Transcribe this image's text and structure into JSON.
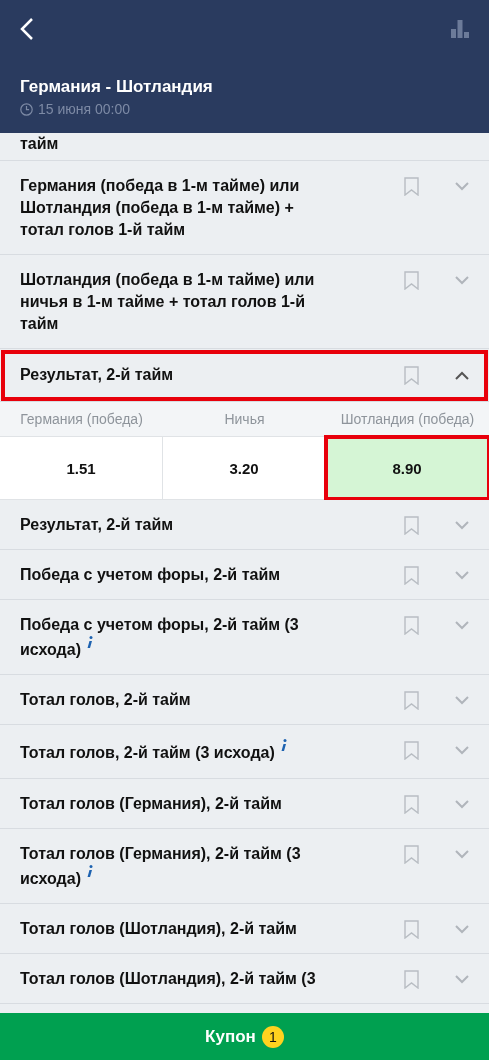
{
  "header": {
    "title": "Германия - Шотландия",
    "datetime": "15 июня 00:00"
  },
  "markets": [
    {
      "title": "тайм",
      "partial": true,
      "expanded": false,
      "highlighted": false
    },
    {
      "title": "Германия (победа в 1-м тайме) или Шотландия (победа в 1-м тайме) + тотал голов 1-й тайм",
      "expanded": false,
      "highlighted": false
    },
    {
      "title": "Шотландия (победа в 1-м тайме) или ничья в 1-м тайме + тотал голов 1-й тайм",
      "expanded": false,
      "highlighted": false
    },
    {
      "title": "Результат, 2-й тайм",
      "expanded": true,
      "highlighted": true,
      "outcomes": [
        {
          "label": "Германия (победа)",
          "odds": "1.51",
          "selected": false
        },
        {
          "label": "Ничья",
          "odds": "3.20",
          "selected": false
        },
        {
          "label": "Шотландия (победа)",
          "odds": "8.90",
          "selected": true
        }
      ]
    },
    {
      "title": "Результат, 2-й тайм",
      "expanded": false,
      "highlighted": false
    },
    {
      "title": "Победа с учетом форы, 2-й тайм",
      "expanded": false,
      "highlighted": false
    },
    {
      "title": "Победа с учетом форы, 2-й тайм (3 исхода)",
      "info": true,
      "expanded": false,
      "highlighted": false
    },
    {
      "title": "Тотал голов, 2-й тайм",
      "expanded": false,
      "highlighted": false
    },
    {
      "title": "Тотал голов, 2-й тайм (3 исхода)",
      "info": true,
      "expanded": false,
      "highlighted": false
    },
    {
      "title": "Тотал голов (Германия), 2-й тайм",
      "expanded": false,
      "highlighted": false
    },
    {
      "title": "Тотал голов (Германия), 2-й тайм (3 исхода)",
      "info": true,
      "expanded": false,
      "highlighted": false
    },
    {
      "title": "Тотал голов (Шотландия), 2-й тайм",
      "expanded": false,
      "highlighted": false
    },
    {
      "title": "Тотал голов (Шотландия), 2-й тайм (3",
      "expanded": false,
      "highlighted": false
    }
  ],
  "coupon": {
    "label": "Купон",
    "count": "1"
  }
}
